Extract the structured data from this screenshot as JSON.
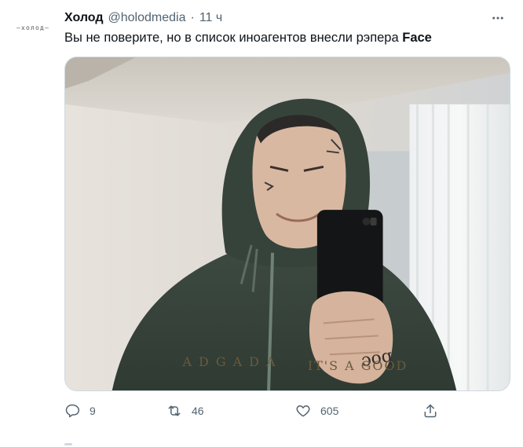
{
  "tweet": {
    "author_name": "Холод",
    "author_handle": "@holodmedia",
    "separator": "·",
    "time": "11 ч",
    "avatar_text": "–холод–",
    "text_main": "Вы не поверите, но в список иноагентов внесли рэпера ",
    "text_bold": "Face",
    "more_icon": "more-horizontal-icon",
    "image_alt": "photo"
  },
  "actions": {
    "replies": "9",
    "retweets": "46",
    "likes": "605",
    "reply_icon": "reply-icon",
    "retweet_icon": "retweet-icon",
    "like_icon": "heart-icon",
    "share_icon": "share-icon"
  },
  "colors": {
    "text": "#0f1419",
    "secondary": "#536471",
    "border": "#cfd9de"
  }
}
